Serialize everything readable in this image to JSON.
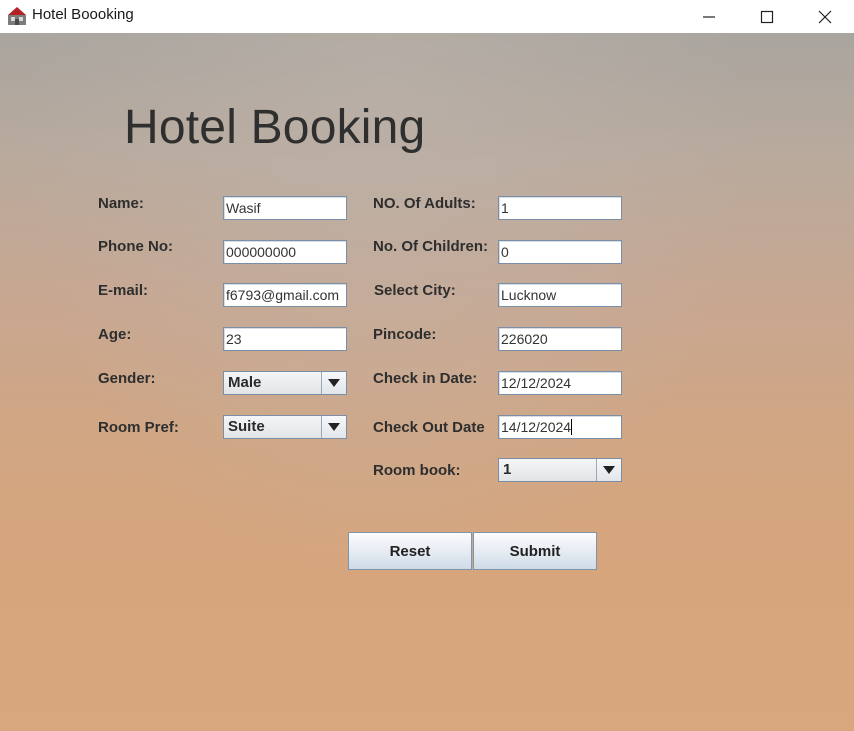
{
  "window": {
    "title": "Hotel Boooking"
  },
  "form": {
    "heading": "Hotel Booking",
    "left": {
      "name": {
        "label": "Name:",
        "value": "Wasif"
      },
      "phone": {
        "label": "Phone No:",
        "value": "000000000"
      },
      "email": {
        "label": "E-mail:",
        "value": "f6793@gmail.com"
      },
      "age": {
        "label": "Age:",
        "value": "23"
      },
      "gender": {
        "label": "Gender:",
        "value": "Male"
      },
      "room_pref": {
        "label": "Room Pref:",
        "value": "Suite"
      }
    },
    "right": {
      "adults": {
        "label": "NO. Of Adults:",
        "value": "1"
      },
      "children": {
        "label": "No. Of Children:",
        "value": "0"
      },
      "city": {
        "label": "Select City:",
        "value": "Lucknow"
      },
      "pincode": {
        "label": "Pincode:",
        "value": "226020"
      },
      "check_in": {
        "label": "Check in Date:",
        "value": "12/12/2024"
      },
      "check_out": {
        "label": "Check Out Date",
        "value": "14/12/2024"
      },
      "room_book": {
        "label": "Room book:",
        "value": "1"
      }
    },
    "buttons": {
      "reset": "Reset",
      "submit": "Submit"
    }
  },
  "icons": {
    "app": "java-app-icon",
    "minimize": "minimize-icon",
    "maximize": "maximize-icon",
    "close": "close-icon",
    "dropdown": "chevron-down-icon"
  }
}
